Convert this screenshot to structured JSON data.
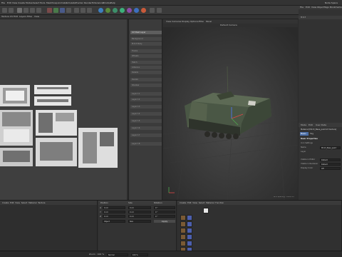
{
  "menubar": {
    "items": [
      "File",
      "Edit",
      "View",
      "Create",
      "Modes",
      "Select",
      "Tools",
      "Mesh",
      "Snap",
      "Animate",
      "Simulate",
      "Tracker",
      "Render",
      "Extensions",
      "Window",
      "Help"
    ],
    "right_label": "Node Space"
  },
  "toolbar": {
    "icons": [
      "undo-icon",
      "redo-icon",
      "select-icon",
      "move-icon",
      "scale-icon",
      "rotate-icon",
      "x-axis-icon",
      "y-axis-icon",
      "z-axis-icon",
      "world-icon",
      "render-view-icon",
      "render-icon",
      "render-settings-icon",
      "cube-icon",
      "pen-icon",
      "subdivision-icon",
      "array-icon",
      "field-icon",
      "deformer-icon",
      "floor-icon",
      "camera-icon",
      "light-icon"
    ],
    "icon_colors": [
      "#5a8a3a",
      "#3d7fbf",
      "#3d8f6a",
      "#8c4ca8",
      "#c95a3a",
      "#3db07a",
      "#6a6a6a",
      "#3d6fbf"
    ]
  },
  "subtool": {
    "items": [
      "Texture",
      "UV Edit",
      "Layers",
      "Filter",
      "View"
    ]
  },
  "layers": {
    "items": [
      "UV Mesh Layer",
      "Background",
      "M113 Body",
      "Tracks",
      "Wheels",
      "Hatch",
      "Antenna",
      "Details",
      "Decals",
      "Shadow",
      "Layer 11",
      "Layer 12",
      "Layer 13",
      "Layer 14",
      "Layer 15",
      "Layer 16",
      "Layer 17",
      "Layer 18"
    ]
  },
  "viewport": {
    "menu": [
      "View",
      "Cameras",
      "Display",
      "Options",
      "Filter",
      "Panel"
    ],
    "title": "Default Camera",
    "grid_spacing": "Grid Spacing : 1000 cm"
  },
  "rightpanel": {
    "tabs": [
      "File",
      "Edit",
      "View",
      "Object",
      "Tags",
      "Bookmarks"
    ],
    "object_name": "M113",
    "attr_tabs": [
      "Mode",
      "Edit",
      "User Data"
    ],
    "material_label": "Material [M113_Base_paint.k3 texture]",
    "attr_subtabs": [
      "Basic",
      "Tag"
    ],
    "section_title": "Basic Properties",
    "icon_label": "Icon Settings",
    "name_label": "Name",
    "name_value": "M113_Base_paint",
    "layer_label": "Layer",
    "visible_editor_label": "Visible in Editor",
    "visible_editor_value": "Default",
    "visible_renderer_label": "Visible in Renderer",
    "visible_renderer_value": "Default",
    "display_color_label": "Display Color",
    "display_color_value": "Off"
  },
  "bottom": {
    "left_tabs": [
      "Create",
      "Edit",
      "View",
      "Select",
      "Material",
      "Texture"
    ],
    "coords_title": "Position",
    "size_title": "Size",
    "rot_title": "Rotation",
    "coord_rows": [
      {
        "axis": "X",
        "pos": "0 cm",
        "size": "0 cm",
        "rot": "0 °"
      },
      {
        "axis": "Y",
        "pos": "0 cm",
        "size": "0 cm",
        "rot": "0 °"
      },
      {
        "axis": "Z",
        "pos": "0 cm",
        "size": "0 cm",
        "rot": "0 °"
      }
    ],
    "mode_value": "Object",
    "size_mode_value": "Size",
    "apply_label": "Apply",
    "layer_tabs": [
      "Create",
      "Edit",
      "View",
      "Select",
      "Material",
      "Function"
    ],
    "footer_left": "Zoom : 100 %",
    "footer_mode": "Normal",
    "footer_value": "100 %"
  }
}
